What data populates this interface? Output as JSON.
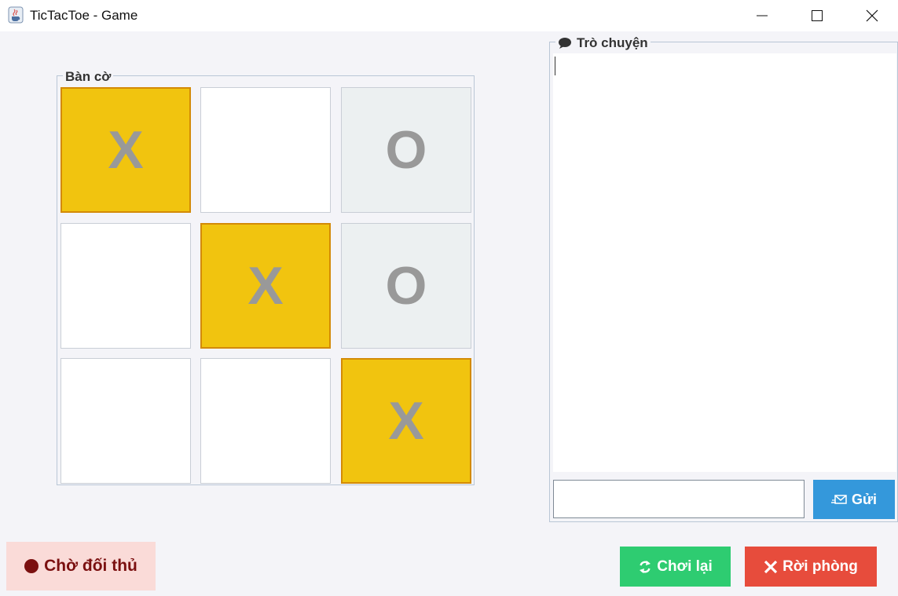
{
  "window": {
    "title": "TicTacToe - Game",
    "app_icon": "java-coffee-icon",
    "controls": [
      "minimize-icon",
      "maximize-icon",
      "close-icon"
    ]
  },
  "board": {
    "legend": "Bàn cờ",
    "cells": [
      [
        "X",
        "",
        "O"
      ],
      [
        "",
        "X",
        "O"
      ],
      [
        "",
        "",
        "X"
      ]
    ],
    "colors": {
      "x_fill": "#f1c40f",
      "x_border": "#d38a06",
      "o_fill": "#ecf0f1",
      "empty_fill": "#ffffff",
      "mark": "#999999"
    }
  },
  "chat": {
    "legend": "Trò chuyện",
    "legend_icon": "speech-bubble-icon",
    "messages": [],
    "input_value": "",
    "send_label": "Gửi",
    "send_icon": "envelope-send-icon",
    "send_color": "#3498db"
  },
  "status": {
    "label": "Chờ đối thủ",
    "icon": "red-circle-icon",
    "bg": "#fadbd8",
    "color": "#7b1010"
  },
  "actions": {
    "replay_label": "Chơi lại",
    "replay_icon": "refresh-icon",
    "replay_color": "#2ecc71",
    "leave_label": "Rời phòng",
    "leave_icon": "x-icon",
    "leave_color": "#e74c3c"
  }
}
